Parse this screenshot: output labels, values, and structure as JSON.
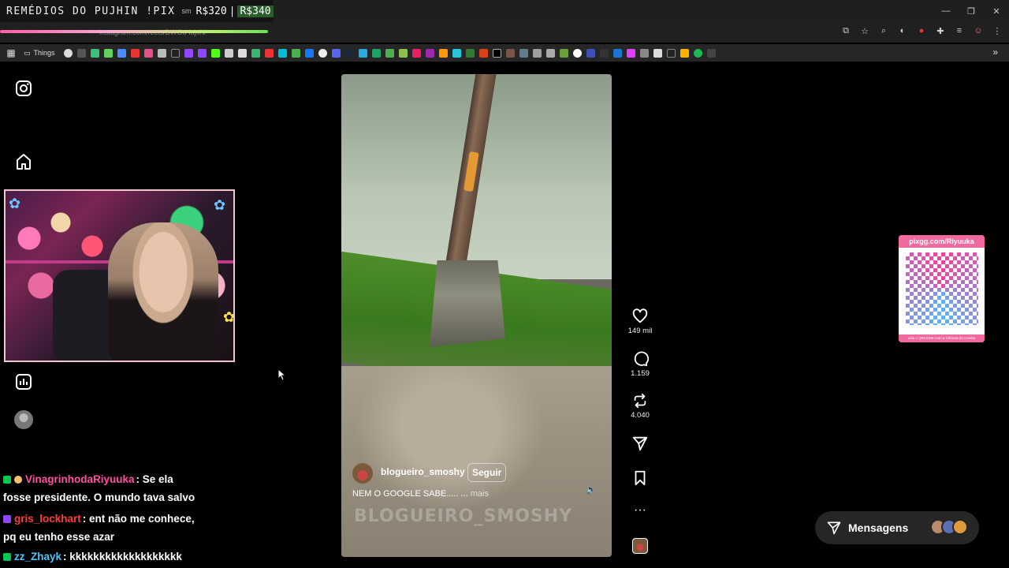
{
  "stream_banner": {
    "title": "REMÉDIOS DO PUJHIN !PIX",
    "small": "sm",
    "amount": "R$320",
    "separator": "|",
    "goal": "R$340"
  },
  "browser": {
    "url": "instagram.com/reels/DWOd-lajxN/",
    "bookmarks_folder": "Things"
  },
  "reel": {
    "author": "blogueiro_smoshy",
    "follow_label": "Seguir",
    "caption": "NEM O GOOGLE SABE..... ...",
    "caption_more": "mais",
    "watermark": "BLOGUEIRO_SMOSHY",
    "likes": "149 mil",
    "comments": "1.159",
    "reposts": "4.040"
  },
  "chat": [
    {
      "user": "VinagrinhodaRiyuuka",
      "user_color": "#ff4fa3",
      "text": ": Se ela",
      "cont": "fosse presidente. O mundo tava salvo",
      "badge": "#00c853"
    },
    {
      "user": "gris_lockhart",
      "user_color": "#ff3b3b",
      "text": ": ent não me conhece,",
      "cont": "pq eu tenho esse azar",
      "badge": "#9147ff"
    },
    {
      "user": "zz_Zhayk",
      "user_color": "#4fc3f7",
      "text": ": kkkkkkkkkkkkkkkkkkk",
      "cont": "",
      "badge": "#00c853"
    }
  ],
  "qr": {
    "header": "pixgg.com/Riyuuka",
    "footer": "Leia o QRCODE com a Câmera do Celular"
  },
  "messages": {
    "label": "Mensagens"
  },
  "colors": {
    "accent_pink": "#f06aa0",
    "chat_green": "#00c853",
    "chat_purple": "#9147ff"
  }
}
